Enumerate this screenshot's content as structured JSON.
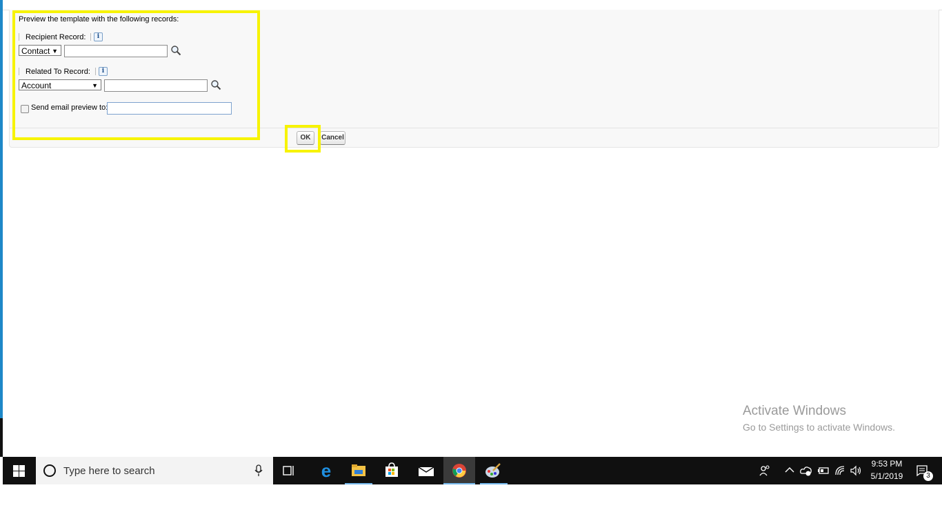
{
  "form": {
    "intro": "Preview the template with the following records:",
    "recipient_label": "Recipient Record:",
    "recipient_type": "Contact",
    "recipient_value": "",
    "related_label": "Related To Record:",
    "related_type": "Account",
    "related_value": "",
    "send_preview_label": "Send email preview to:",
    "send_preview_value": "",
    "send_preview_checked": false,
    "info_glyph": "i"
  },
  "buttons": {
    "ok": "OK",
    "cancel": "Cancel"
  },
  "watermark": {
    "title": "Activate Windows",
    "subtitle": "Go to Settings to activate Windows."
  },
  "taskbar": {
    "search_placeholder": "Type here to search",
    "time": "9:53 PM",
    "date": "5/1/2019",
    "notification_count": "3",
    "apps": [
      "task-view",
      "edge",
      "file-explorer",
      "store",
      "mail",
      "chrome",
      "paint"
    ]
  },
  "colors": {
    "highlight": "#f7f300",
    "accent": "#1e88c8"
  }
}
